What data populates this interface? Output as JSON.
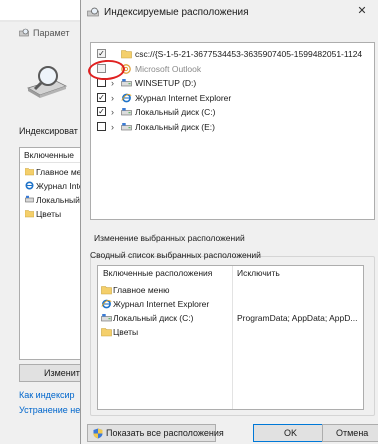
{
  "background_window": {
    "title": "Парамет",
    "indexing_label": "Индексироват",
    "list_header": "Включенные",
    "list_items": [
      "Главное ме",
      "Журнал Inte",
      "Локальный",
      "Цветы"
    ],
    "modify_button": "Изменит",
    "links": [
      "Как индексир",
      "Устранение не"
    ]
  },
  "dialog": {
    "title": "Индексируемые расположения",
    "tree": [
      {
        "checked": true,
        "disabled": true,
        "chevron": false,
        "icon": "folder-icon",
        "label": "csc://{S-1-5-21-3677534453-3635907405-1599482051-1124"
      },
      {
        "checked": false,
        "disabled": true,
        "chevron": false,
        "icon": "outlook-icon",
        "label": "Microsoft Outlook"
      },
      {
        "checked": false,
        "disabled": false,
        "chevron": true,
        "icon": "drive-icon",
        "label": "WINSETUP (D:)"
      },
      {
        "checked": true,
        "disabled": false,
        "chevron": true,
        "icon": "ie-icon",
        "label": "Журнал Internet Explorer"
      },
      {
        "checked": true,
        "disabled": false,
        "chevron": true,
        "icon": "drive-icon",
        "label": "Локальный диск (C:)"
      },
      {
        "checked": false,
        "disabled": false,
        "chevron": true,
        "icon": "drive-icon",
        "label": "Локальный диск (E:)"
      }
    ],
    "change_label": "Изменение выбранных расположений",
    "summary_title": "Сводный список выбранных расположений",
    "columns": {
      "included": "Включенные расположения",
      "exclude": "Исключить"
    },
    "summary_rows": [
      {
        "icon": "folder-icon",
        "label": "Главное меню",
        "exclude": ""
      },
      {
        "icon": "ie-icon",
        "label": "Журнал Internet Explorer",
        "exclude": ""
      },
      {
        "icon": "drive-icon",
        "label": "Локальный диск (C:)",
        "exclude": "ProgramData; AppData; AppD..."
      },
      {
        "icon": "folder-icon",
        "label": "Цветы",
        "exclude": ""
      }
    ],
    "buttons": {
      "show_all": "Показать все расположения",
      "ok": "OK",
      "cancel": "Отмена"
    }
  },
  "colors": {
    "annotation": "#e02020",
    "folder": "#f4cf6b",
    "link": "#0066cc",
    "ok_border": "#0078d7"
  }
}
